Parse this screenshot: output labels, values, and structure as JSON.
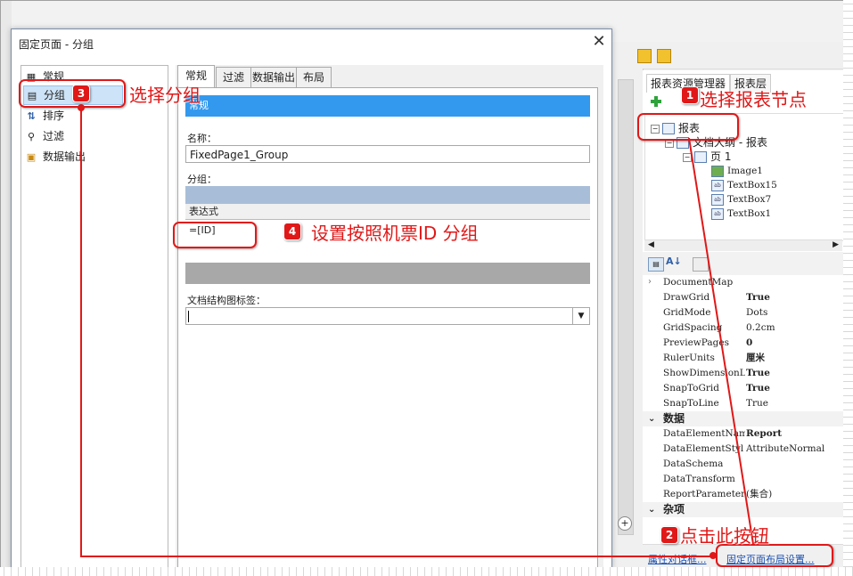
{
  "dialog": {
    "title": "固定页面 - 分组",
    "close_glyph": "✕",
    "nav": [
      {
        "label": "常规"
      },
      {
        "label": "分组"
      },
      {
        "label": "排序"
      },
      {
        "label": "过滤"
      },
      {
        "label": "数据输出"
      }
    ],
    "tabs": [
      "常规",
      "过滤",
      "数据输出",
      "布局"
    ],
    "section_header": "常规",
    "name_label": "名称：",
    "name_value": "FixedPage1_Group",
    "group_label": "分组：",
    "expression_header": "表达式",
    "expression_value": "=[ID]",
    "docmap_label": "文档结构图标签："
  },
  "right_panel": {
    "tabs": [
      "报表资源管理器",
      "报表层"
    ],
    "tree": [
      {
        "label": "报表"
      },
      {
        "label": "文档大纲 - 报表"
      },
      {
        "label": "页 1"
      },
      {
        "label": "Image1"
      },
      {
        "label": "TextBox15"
      },
      {
        "label": "TextBox7"
      },
      {
        "label": "TextBox1"
      }
    ],
    "properties": [
      {
        "name": "DocumentMap",
        "value": ""
      },
      {
        "name": "DrawGrid",
        "value": "True"
      },
      {
        "name": "GridMode",
        "value": "Dots"
      },
      {
        "name": "GridSpacing",
        "value": "0.2cm"
      },
      {
        "name": "PreviewPages",
        "value": "0"
      },
      {
        "name": "RulerUnits",
        "value": "厘米"
      },
      {
        "name": "ShowDimensionLi",
        "value": "True"
      },
      {
        "name": "SnapToGrid",
        "value": "True"
      },
      {
        "name": "SnapToLine",
        "value": "True"
      }
    ],
    "cat_data": "数据",
    "data_props": [
      {
        "name": "DataElementName",
        "value": "Report"
      },
      {
        "name": "DataElementStyl",
        "value": "AttributeNormal"
      },
      {
        "name": "DataSchema",
        "value": ""
      },
      {
        "name": "DataTransform",
        "value": ""
      },
      {
        "name": "ReportParameter",
        "value": "(集合)"
      }
    ],
    "cat_misc": "杂项",
    "bottom_links": [
      "属性对话框...",
      "固定页面布局设置..."
    ]
  },
  "annotations": [
    {
      "num": "1",
      "text": "选择报表节点"
    },
    {
      "num": "2",
      "text": "点击此按钮"
    },
    {
      "num": "3",
      "text": "选择分组"
    },
    {
      "num": "4",
      "text": "设置按照机票ID 分组"
    }
  ],
  "colors": {
    "annotation": "#e01818",
    "section_header": "#3399ee",
    "link": "#1a4fb0"
  }
}
